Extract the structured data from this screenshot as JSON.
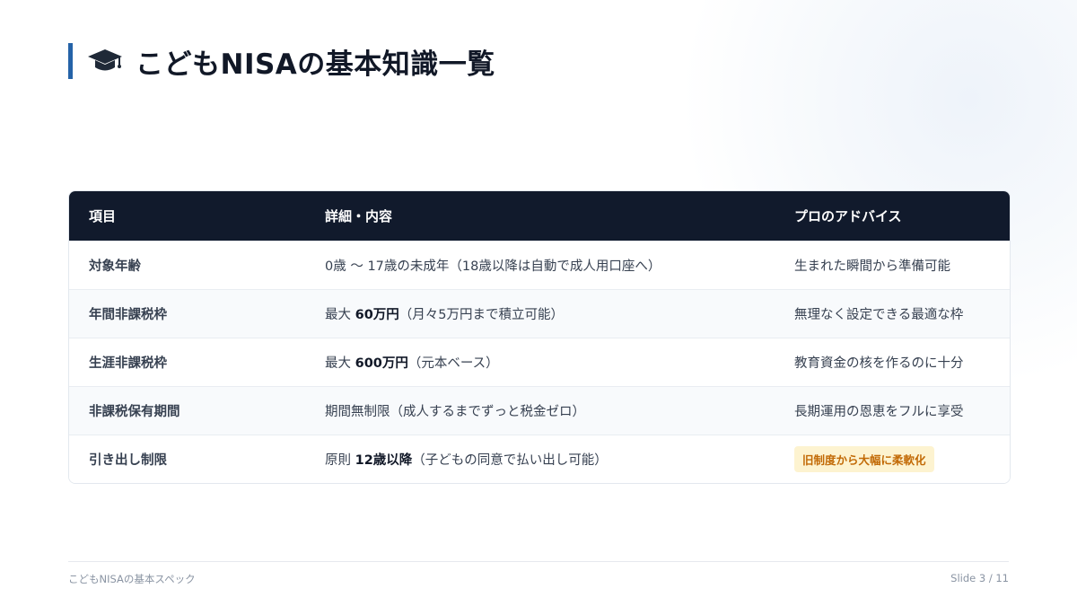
{
  "title": "こどもNISAの基本知識一覧",
  "icons": {
    "title_icon": "graduation-cap-icon"
  },
  "colors": {
    "accent": "#2563a8",
    "header_bg": "#111a2c",
    "badge_bg": "#fdf3d0",
    "badge_text": "#c26a06"
  },
  "table": {
    "headers": [
      "項目",
      "詳細・内容",
      "プロのアドバイス"
    ],
    "rows": [
      {
        "item": "対象年齢",
        "detail_pre": "0歳 〜 17歳の未成年（18歳以降は自動で成人用口座へ）",
        "detail_bold": "",
        "detail_post": "",
        "advice": "生まれた瞬間から準備可能"
      },
      {
        "item": "年間非課税枠",
        "detail_pre": "最大 ",
        "detail_bold": "60万円",
        "detail_post": "（月々5万円まで積立可能）",
        "advice": "無理なく設定できる最適な枠"
      },
      {
        "item": "生涯非課税枠",
        "detail_pre": "最大 ",
        "detail_bold": "600万円",
        "detail_post": "（元本ベース）",
        "advice": "教育資金の核を作るのに十分"
      },
      {
        "item": "非課税保有期間",
        "detail_pre": "期間無制限（成人するまでずっと税金ゼロ）",
        "detail_bold": "",
        "detail_post": "",
        "advice": "長期運用の恩恵をフルに享受"
      },
      {
        "item": "引き出し制限",
        "detail_pre": "原則 ",
        "detail_bold": "12歳以降",
        "detail_post": "（子どもの同意で払い出し可能）",
        "advice": "旧制度から大幅に柔軟化"
      }
    ]
  },
  "footer": {
    "left": "こどもNISAの基本スペック",
    "right": "Slide 3 / 11"
  }
}
